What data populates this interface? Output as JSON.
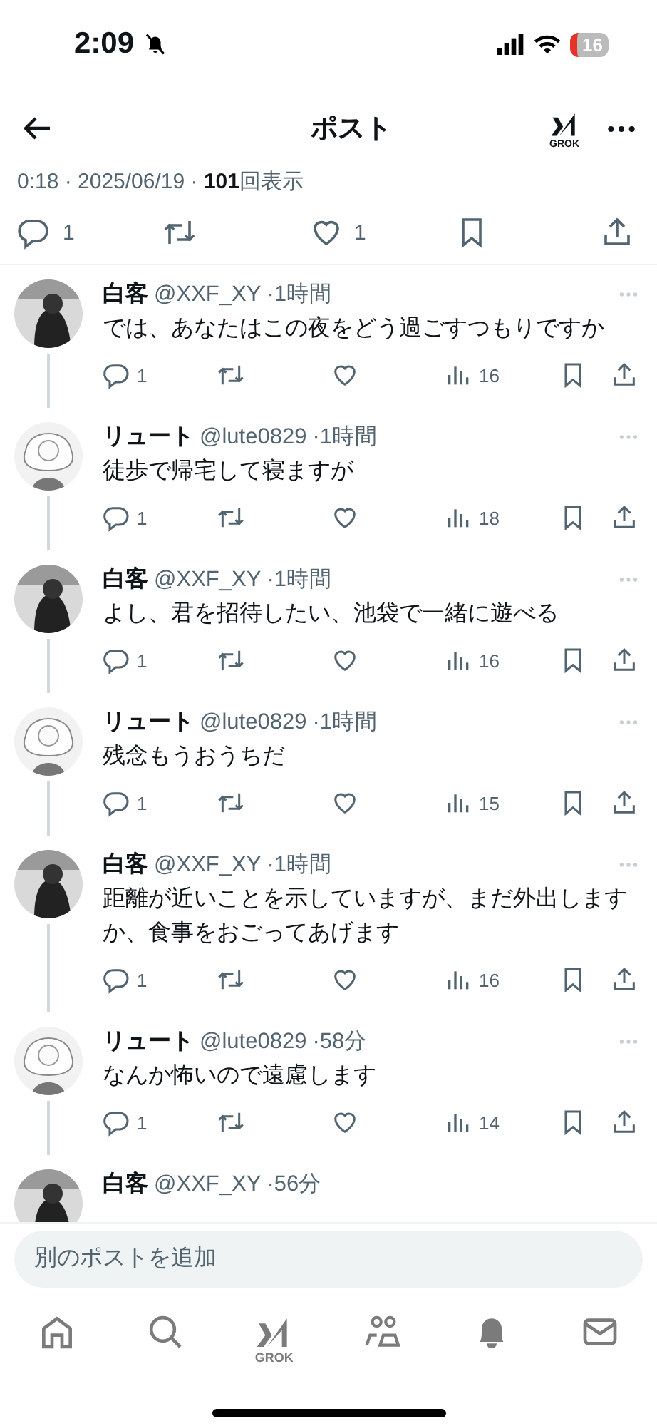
{
  "status_bar": {
    "time": "2:09",
    "battery": "16"
  },
  "header": {
    "title": "ポスト",
    "grok_label": "GROK"
  },
  "post_meta": "0:18 · 2025/06/19 · **101**回表示",
  "post_actions": {
    "replies": "1",
    "likes": "1"
  },
  "replies": [
    {
      "kind": "full",
      "avatar": {
        "kind": "dark"
      },
      "name": "白客",
      "handle": "@XXF_XY",
      "time": "·1時間",
      "text": "では、あなたはこの夜をどう過ごすつもりですか",
      "replies": "1",
      "views": "16"
    },
    {
      "kind": "full",
      "avatar": {
        "kind": "sketch"
      },
      "name": "リュート",
      "handle": "@lute0829",
      "time": "·1時間",
      "text": "徒歩で帰宅して寝ますが",
      "replies": "1",
      "views": "18"
    },
    {
      "kind": "full",
      "avatar": {
        "kind": "dark"
      },
      "name": "白客",
      "handle": "@XXF_XY",
      "time": "·1時間",
      "text": "よし、君を招待したい、池袋で一緒に遊べる",
      "replies": "1",
      "views": "16"
    },
    {
      "kind": "full",
      "avatar": {
        "kind": "sketch"
      },
      "name": "リュート",
      "handle": "@lute0829",
      "time": "·1時間",
      "text": "残念もうおうちだ",
      "replies": "1",
      "views": "15"
    },
    {
      "kind": "full",
      "avatar": {
        "kind": "dark"
      },
      "name": "白客",
      "handle": "@XXF_XY",
      "time": "·1時間",
      "text": "距離が近いことを示していますが、まだ外出しますか、食事をおごってあげます",
      "replies": "1",
      "views": "16"
    },
    {
      "kind": "full",
      "avatar": {
        "kind": "sketch"
      },
      "name": "リュート",
      "handle": "@lute0829",
      "time": "·58分",
      "text": "なんか怖いので遠慮します",
      "replies": "1",
      "views": "14"
    },
    {
      "kind": "partial",
      "avatar": {
        "kind": "dark"
      },
      "name": "白客",
      "handle": "@XXF_XY",
      "time": "·56分"
    }
  ],
  "composer": {
    "placeholder": "別のポストを追加"
  },
  "tab_bar": [
    {
      "kind": "home"
    },
    {
      "kind": "search"
    },
    {
      "kind": "grok",
      "label": "GROK"
    },
    {
      "kind": "communities"
    },
    {
      "kind": "notifications"
    },
    {
      "kind": "messages"
    }
  ]
}
